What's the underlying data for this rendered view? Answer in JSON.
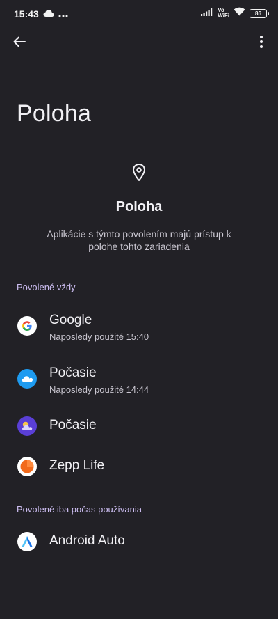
{
  "status_bar": {
    "time": "15:43",
    "volte_top": "Vo",
    "volte_bottom": "WiFi",
    "battery": "86"
  },
  "toolbar": {
    "back_icon": "arrow-back-icon",
    "more_icon": "more-vert-icon"
  },
  "page": {
    "title": "Poloha"
  },
  "header": {
    "icon": "location-pin-icon",
    "title": "Poloha",
    "description": "Aplikácie s týmto povolením majú prístup k polohe tohto zariadenia"
  },
  "sections": [
    {
      "title": "Povolené vždy",
      "apps": [
        {
          "name": "Google",
          "subtitle": "Naposledy použité 15:40",
          "icon": "google-icon"
        },
        {
          "name": "Počasie",
          "subtitle": "Naposledy použité 14:44",
          "icon": "weather-cloud-icon"
        },
        {
          "name": "Počasie",
          "subtitle": "",
          "icon": "weather-sun-cloud-icon"
        },
        {
          "name": "Zepp Life",
          "subtitle": "",
          "icon": "zepp-life-icon"
        }
      ]
    },
    {
      "title": "Povolené iba počas používania",
      "apps": [
        {
          "name": "Android Auto",
          "subtitle": "",
          "icon": "android-auto-icon"
        }
      ]
    }
  ],
  "colors": {
    "background": "#222126",
    "accent": "#CDBEF2",
    "text_primary": "#F2F1F5",
    "text_secondary": "#C9C6D0"
  }
}
